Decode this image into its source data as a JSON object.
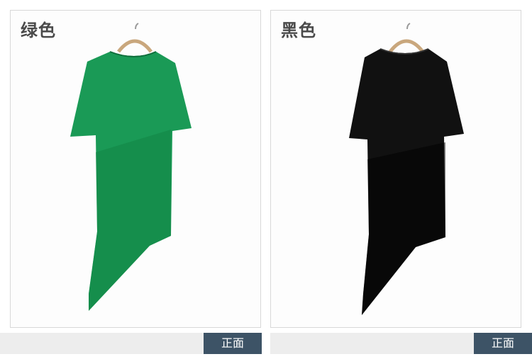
{
  "panels": [
    {
      "color_label": "绿色",
      "dress_color": "#1a9a56",
      "dress_shade": "#138546",
      "footer_tag": "正面"
    },
    {
      "color_label": "黑色",
      "dress_color": "#111111",
      "dress_shade": "#000000",
      "footer_tag": "正面"
    }
  ]
}
